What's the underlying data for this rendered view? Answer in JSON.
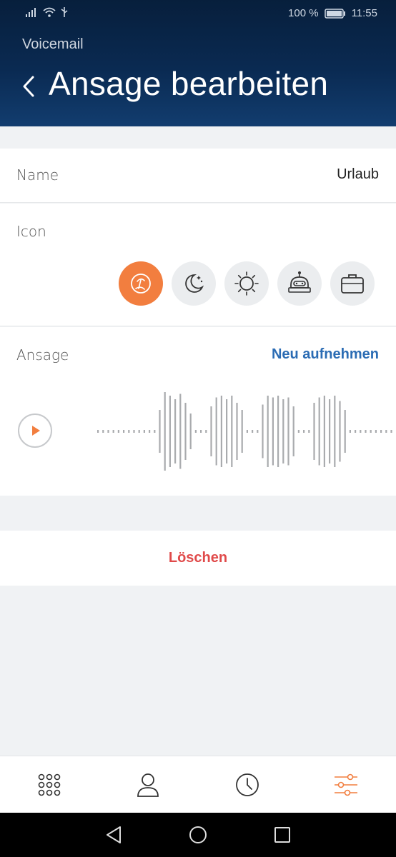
{
  "status_bar": {
    "battery": "100 %",
    "time": "11:55"
  },
  "header": {
    "section": "Voicemail",
    "title": "Ansage bearbeiten"
  },
  "name_row": {
    "label": "Name",
    "value": "Urlaub"
  },
  "icon_row": {
    "label": "Icon",
    "options": [
      {
        "name": "vacation-icon",
        "selected": true
      },
      {
        "name": "night-icon",
        "selected": false
      },
      {
        "name": "sun-icon",
        "selected": false
      },
      {
        "name": "robot-icon",
        "selected": false
      },
      {
        "name": "briefcase-icon",
        "selected": false
      }
    ]
  },
  "ansage_row": {
    "label": "Ansage",
    "record_link": "Neu aufnehmen"
  },
  "delete": {
    "label": "Löschen"
  },
  "colors": {
    "accent": "#f27e3f",
    "link": "#2b6cb4",
    "danger": "#e04a4a",
    "header_bg": "#0a2a52"
  },
  "tabbar": {
    "active": "settings"
  }
}
